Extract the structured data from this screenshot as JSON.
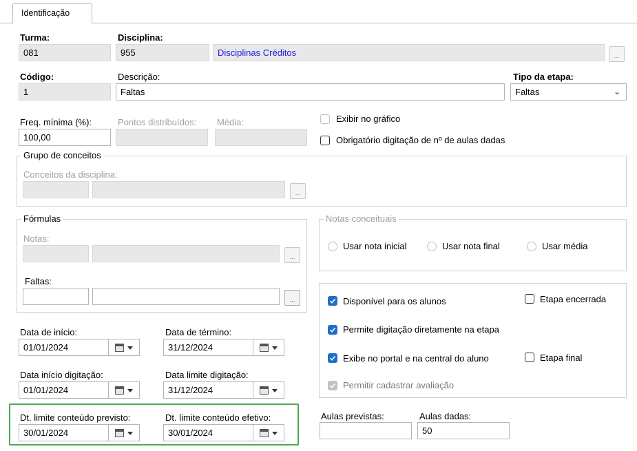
{
  "tabs": [
    {
      "label": "Identificação"
    }
  ],
  "turma": {
    "label": "Turma:",
    "value": "081"
  },
  "disciplina": {
    "label": "Disciplina:",
    "code": "955",
    "name": "Disciplinas Créditos",
    "lookup_label": "..."
  },
  "codigo": {
    "label": "Código:",
    "value": "1"
  },
  "descricao": {
    "label": "Descrição:",
    "value": "Faltas"
  },
  "tipo_etapa": {
    "label": "Tipo da etapa:",
    "value": "Faltas"
  },
  "freq_minima": {
    "label": "Freq. mínima (%):",
    "value": "100,00"
  },
  "pontos_distribuidos": {
    "label": "Pontos distribuídos:",
    "value": ""
  },
  "media": {
    "label": "Média:",
    "value": ""
  },
  "exibir_grafico": {
    "label": "Exibir no gráfico",
    "checked": false,
    "enabled": false
  },
  "obrigatorio_aulas": {
    "label": "Obrigatório digitação de nº de aulas dadas",
    "checked": false
  },
  "grupo_conceitos": {
    "title": "Grupo de conceitos",
    "conceitos_label": "Conceitos da disciplina:",
    "lookup_label": "..."
  },
  "formulas": {
    "title": "Fórmulas",
    "notas_label": "Notas:",
    "faltas_label": "Faltas:",
    "lookup_label": "..."
  },
  "notas_conceituais": {
    "title": "Notas conceituais",
    "options": [
      {
        "label": "Usar nota inicial",
        "selected": false
      },
      {
        "label": "Usar nota final",
        "selected": false
      },
      {
        "label": "Usar média",
        "selected": false
      }
    ]
  },
  "opcoes": {
    "disponivel_alunos": {
      "label": "Disponível para os alunos",
      "checked": true
    },
    "etapa_encerrada": {
      "label": "Etapa encerrada",
      "checked": false
    },
    "permite_digitacao": {
      "label": "Permite digitação diretamente na etapa",
      "checked": true
    },
    "exibe_portal": {
      "label": "Exibe no portal e na central do aluno",
      "checked": true
    },
    "etapa_final": {
      "label": "Etapa final",
      "checked": false
    },
    "permitir_avaliacao": {
      "label": "Permitir cadastrar avaliação",
      "checked": true,
      "enabled": false
    }
  },
  "datas": {
    "inicio": {
      "label": "Data de início:",
      "value": "01/01/2024"
    },
    "termino": {
      "label": "Data de término:",
      "value": "31/12/2024"
    },
    "inicio_digitacao": {
      "label": "Data início digitação:",
      "value": "01/01/2024"
    },
    "limite_digitacao": {
      "label": "Data limite digitação:",
      "value": "31/12/2024"
    },
    "limite_conteudo_previsto": {
      "label": "Dt. limite conteúdo previsto:",
      "value": "30/01/2024"
    },
    "limite_conteudo_efetivo": {
      "label": "Dt. limite conteúdo efetivo:",
      "value": "30/01/2024"
    }
  },
  "aulas": {
    "previstas": {
      "label": "Aulas previstas:",
      "value": ""
    },
    "dadas": {
      "label": "Aulas dadas:",
      "value": "50"
    }
  },
  "colors": {
    "accent_checkbox": "#1e6fc8",
    "highlight_border": "#4ea74e",
    "link_text": "#1a1ae6"
  }
}
